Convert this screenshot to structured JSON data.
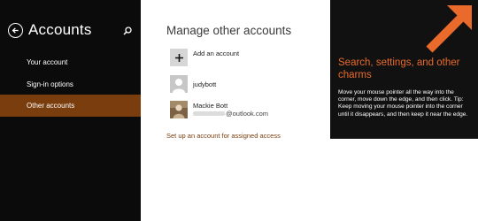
{
  "sidebar": {
    "title": "Accounts",
    "back_icon": "back-arrow-icon",
    "search_icon": "search-icon",
    "items": [
      {
        "label": "Your account",
        "selected": false
      },
      {
        "label": "Sign-in options",
        "selected": false
      },
      {
        "label": "Other accounts",
        "selected": true
      }
    ]
  },
  "main": {
    "title": "Manage other accounts",
    "add_account": {
      "label": "Add an account",
      "icon": "plus-icon"
    },
    "accounts": [
      {
        "name": "judybott",
        "icon": "user-silhouette-icon"
      },
      {
        "name": "Mackie Bott",
        "email_suffix": "@outlook.com",
        "icon": "user-photo"
      }
    ],
    "assigned_access_link": "Set up an account for assigned access"
  },
  "tip": {
    "title": "Search, settings, and other charms",
    "body": "Move your mouse pointer all the way into the corner, move down the edge, and then click. Tip: Keep moving your mouse pointer into the corner until it disappears, and then keep it near the edge.",
    "arrow_icon": "corner-arrow-icon"
  },
  "colors": {
    "sidebar_bg": "#0b0b0b",
    "accent": "#7a3d0d",
    "tip_accent": "#e96a2b",
    "tip_bg": "#111111"
  }
}
